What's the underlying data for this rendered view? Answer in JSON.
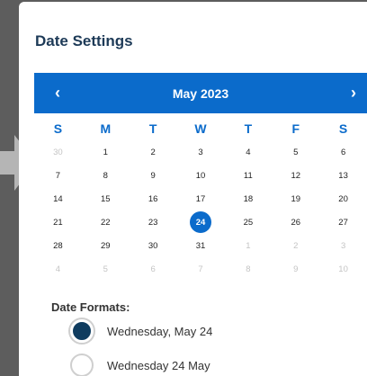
{
  "dialog": {
    "title": "Date Settings"
  },
  "calendar": {
    "month_label": "May 2023",
    "prev_icon": "chevron-left-icon",
    "next_icon": "chevron-right-icon",
    "prev_glyph": "‹",
    "next_glyph": "›",
    "weekdays": [
      "S",
      "M",
      "T",
      "W",
      "T",
      "F",
      "S"
    ],
    "weeks": [
      [
        {
          "d": "30",
          "m": true
        },
        {
          "d": "1"
        },
        {
          "d": "2"
        },
        {
          "d": "3"
        },
        {
          "d": "4"
        },
        {
          "d": "5"
        },
        {
          "d": "6"
        }
      ],
      [
        {
          "d": "7"
        },
        {
          "d": "8"
        },
        {
          "d": "9"
        },
        {
          "d": "10"
        },
        {
          "d": "11"
        },
        {
          "d": "12"
        },
        {
          "d": "13"
        }
      ],
      [
        {
          "d": "14"
        },
        {
          "d": "15"
        },
        {
          "d": "16"
        },
        {
          "d": "17"
        },
        {
          "d": "18"
        },
        {
          "d": "19"
        },
        {
          "d": "20"
        }
      ],
      [
        {
          "d": "21"
        },
        {
          "d": "22"
        },
        {
          "d": "23"
        },
        {
          "d": "24",
          "s": true
        },
        {
          "d": "25"
        },
        {
          "d": "26"
        },
        {
          "d": "27"
        }
      ],
      [
        {
          "d": "28"
        },
        {
          "d": "29"
        },
        {
          "d": "30"
        },
        {
          "d": "31"
        },
        {
          "d": "1",
          "m": true
        },
        {
          "d": "2",
          "m": true
        },
        {
          "d": "3",
          "m": true
        }
      ],
      [
        {
          "d": "4",
          "m": true
        },
        {
          "d": "5",
          "m": true
        },
        {
          "d": "6",
          "m": true
        },
        {
          "d": "7",
          "m": true
        },
        {
          "d": "8",
          "m": true
        },
        {
          "d": "9",
          "m": true
        },
        {
          "d": "10",
          "m": true
        }
      ]
    ],
    "accent_color": "#0b6bcb"
  },
  "formats": {
    "label": "Date Formats:",
    "options": [
      {
        "label": "Wednesday, May 24",
        "checked": true
      },
      {
        "label": "Wednesday 24 May",
        "checked": false
      }
    ]
  }
}
